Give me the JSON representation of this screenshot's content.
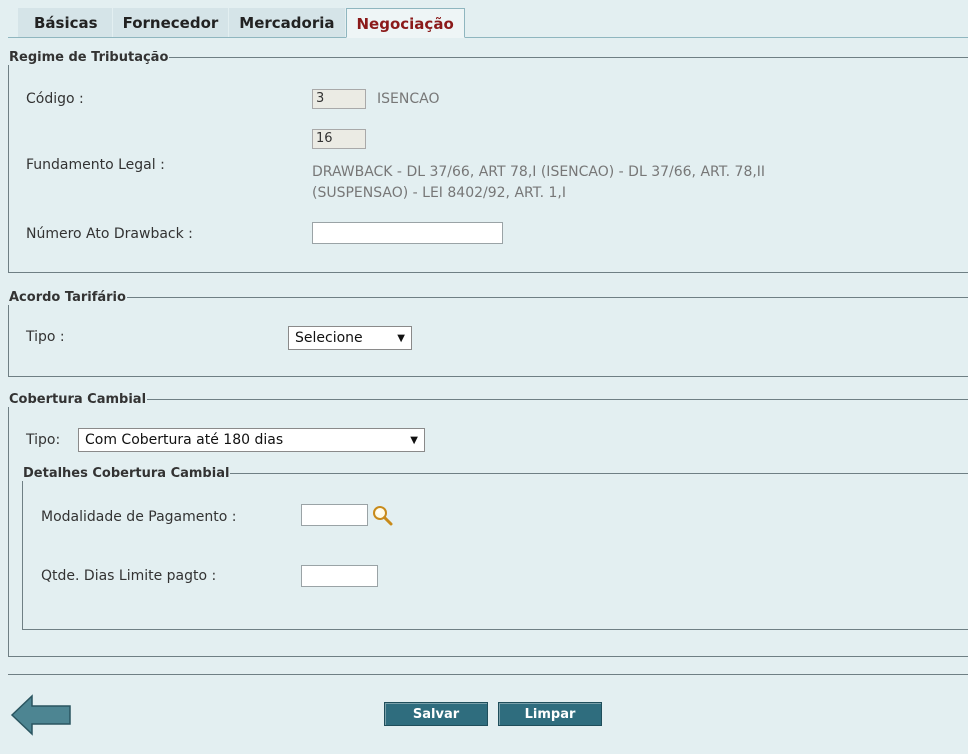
{
  "tabs": [
    {
      "label": "Básicas",
      "active": false
    },
    {
      "label": "Fornecedor",
      "active": false
    },
    {
      "label": "Mercadoria",
      "active": false
    },
    {
      "label": "Negociação",
      "active": true
    }
  ],
  "regime": {
    "legend": "Regime de Tributação",
    "codigo_label": "Código :",
    "codigo_value": "3",
    "codigo_desc": "ISENCAO",
    "fundamento_label": "Fundamento Legal :",
    "fundamento_value": "16",
    "fundamento_desc_line1": "DRAWBACK - DL 37/66, ART 78,I (ISENCAO) - DL 37/66, ART. 78,II",
    "fundamento_desc_line2": "(SUSPENSAO) - LEI 8402/92, ART. 1,I",
    "ato_label": "Número Ato Drawback :",
    "ato_value": ""
  },
  "acordo": {
    "legend": "Acordo Tarifário",
    "tipo_label": "Tipo :",
    "tipo_selected": "Selecione"
  },
  "cobertura": {
    "legend": "Cobertura Cambial",
    "tipo_label": "Tipo:",
    "tipo_selected": "Com Cobertura até 180 dias",
    "detalhes": {
      "legend": "Detalhes Cobertura Cambial",
      "modalidade_label": "Modalidade de Pagamento :",
      "modalidade_value": "",
      "qtde_label": "Qtde. Dias Limite pagto :",
      "qtde_value": ""
    }
  },
  "actions": {
    "salvar_label": "Salvar",
    "limpar_label": "Limpar"
  },
  "colors": {
    "background": "#e3eff1",
    "active_tab_text": "#8b1a1a",
    "button": "#2f6d7e"
  }
}
